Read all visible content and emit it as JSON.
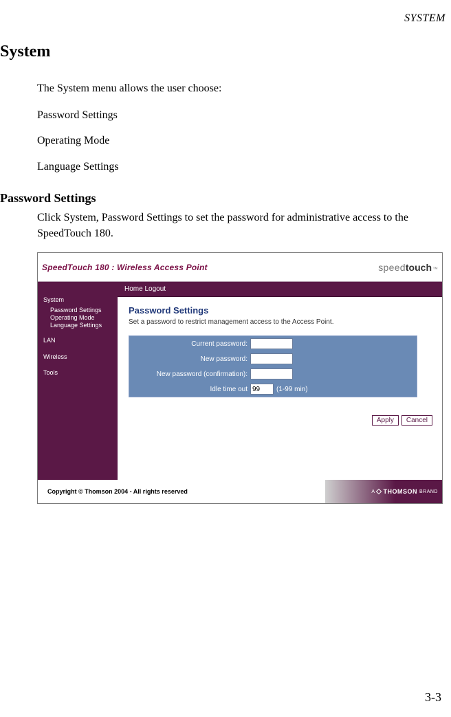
{
  "running_head": "SYSTEM",
  "page_number": "3-3",
  "h1": "System",
  "intro": "The System menu allows the user choose:",
  "menu_items": [
    "Password Settings",
    "Operating Mode",
    "Language Settings"
  ],
  "h2": "Password Settings",
  "h2_body": "Click System, Password Settings to set the password for administrative access to the SpeedTouch 180.",
  "shot": {
    "title": "SpeedTouch 180 : Wireless Access Point",
    "brand_light": "speed",
    "brand_bold": "touch",
    "brand_tm": "™",
    "toolbar": "Home Logout",
    "sidebar": {
      "group1_label": "System",
      "group1_items": [
        "Password Settings",
        "Operating Mode",
        "Language Settings"
      ],
      "group2_label": "LAN",
      "group3_label": "Wireless",
      "group4_label": "Tools"
    },
    "panel_title": "Password Settings",
    "panel_sub": "Set a password to restrict management access to the Access Point.",
    "fields": {
      "current_password_label": "Current password:",
      "new_password_label": "New password:",
      "confirm_label": "New password (confirmation):",
      "idle_label": "Idle time out",
      "idle_value": "99",
      "idle_hint": "(1-99 min)"
    },
    "buttons": {
      "apply": "Apply",
      "cancel": "Cancel"
    },
    "copyright": "Copyright © Thomson 2004 - All rights reserved",
    "thomson_a": "A",
    "thomson_name": "THOMSON",
    "thomson_brand": "BRAND"
  }
}
